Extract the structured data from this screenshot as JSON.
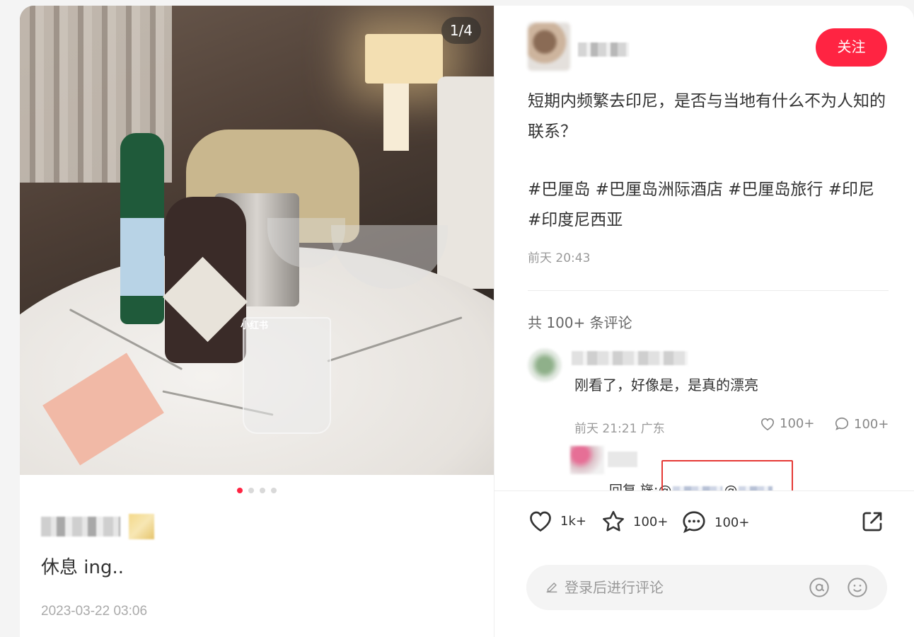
{
  "image_counter": "1/4",
  "carousel": {
    "total": 4,
    "active": 0
  },
  "watermark": "小红书",
  "post": {
    "title": "休息 ing..",
    "date": "2023-03-22 03:06",
    "description": "短期内频繁去印尼，是否与当地有什么不为人知的联系？",
    "tags": "#巴厘岛 #巴厘岛洲际酒店 #巴厘岛旅行 #印尼 #印度尼西亚",
    "time": "前天 20:43"
  },
  "author": {
    "follow_label": "关注"
  },
  "comments": {
    "count_label": "共 100+ 条评论",
    "items": [
      {
        "text": "刚看了，好像是，是真的漂亮",
        "meta": "前天 21:21  广东",
        "likes": "100+",
        "replies": "100+",
        "reply": {
          "prefix": "回复 旛:",
          "at1": "@",
          "at2": "@"
        }
      }
    ]
  },
  "actions": {
    "likes": "1k+",
    "favorites": "100+",
    "comments": "100+"
  },
  "comment_input": {
    "placeholder": "登录后进行评论"
  },
  "icons": [
    "heart-icon",
    "star-icon",
    "comment-icon",
    "share-icon",
    "pen-icon",
    "at-icon",
    "emoji-icon"
  ],
  "colors": {
    "accent": "#ff2442",
    "highlight_box": "#e53935"
  }
}
